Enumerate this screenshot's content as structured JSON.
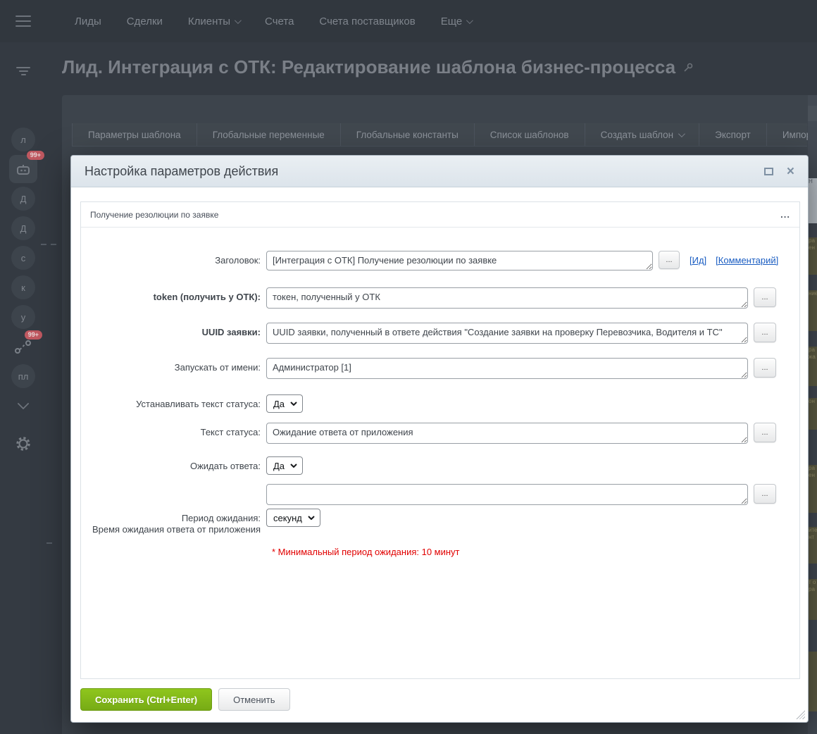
{
  "topnav": {
    "items": [
      "Лиды",
      "Сделки",
      "Клиенты",
      "Счета",
      "Счета поставщиков",
      "Еще"
    ]
  },
  "page_title": "Лид. Интеграция с ОТК: Редактирование шаблона бизнес-процесса",
  "toolbar_tabs": [
    "Параметры шаблона",
    "Глобальные переменные",
    "Глобальные константы",
    "Список шаблонов",
    "Создать шаблон",
    "Экспорт",
    "Импорт"
  ],
  "sidebar": {
    "avatar_letters": [
      "л",
      "Д",
      "Д",
      "с",
      "к",
      "у",
      "пл"
    ],
    "messenger_badge": "99+",
    "processes_badge": "99+"
  },
  "background_fragments": [
    "ра ен",
    "ние",
    "ра жа",
    "он",
    "ра ен",
    "ите нт",
    "т о ра",
    ""
  ],
  "ui": {
    "dots": "...",
    "ellipsis_menu": "...",
    "close": "×"
  },
  "modal": {
    "title": "Настройка параметров действия",
    "activity_header": {
      "title": "Получение резолюции по заявке"
    },
    "fields": [
      {
        "label": "Заголовок:",
        "value": "[Интеграция с ОТК] Получение резолюции по заявке"
      },
      {
        "label": "token (получить у ОТК):",
        "value": "токен, полученный у ОТК"
      },
      {
        "label": "UUID заявки:",
        "value": "UUID заявки, полученный в ответе действия \"Создание заявки на проверку Перевозчика, Водителя и ТС\""
      },
      {
        "label": "Запускать от имени:",
        "value": "Администратор [1]"
      },
      {
        "label": "Устанавливать текст статуса:",
        "value": "Да"
      },
      {
        "label": "Текст статуса:",
        "value": "Ожидание ответа от приложения"
      },
      {
        "label": "Ожидать ответа:",
        "value": "Да"
      },
      {
        "label": "",
        "value": ""
      },
      {
        "label": "Период ожидания:",
        "sublabel": "Время ожидания ответа от приложения",
        "value": "секунд"
      }
    ],
    "links": {
      "id": "[Ид]",
      "comment": "[Комментарий]"
    },
    "warning": "* Минимальный период ожидания: 10 минут",
    "footer": {
      "save": "Сохранить (Ctrl+Enter)",
      "cancel": "Отменить"
    }
  }
}
